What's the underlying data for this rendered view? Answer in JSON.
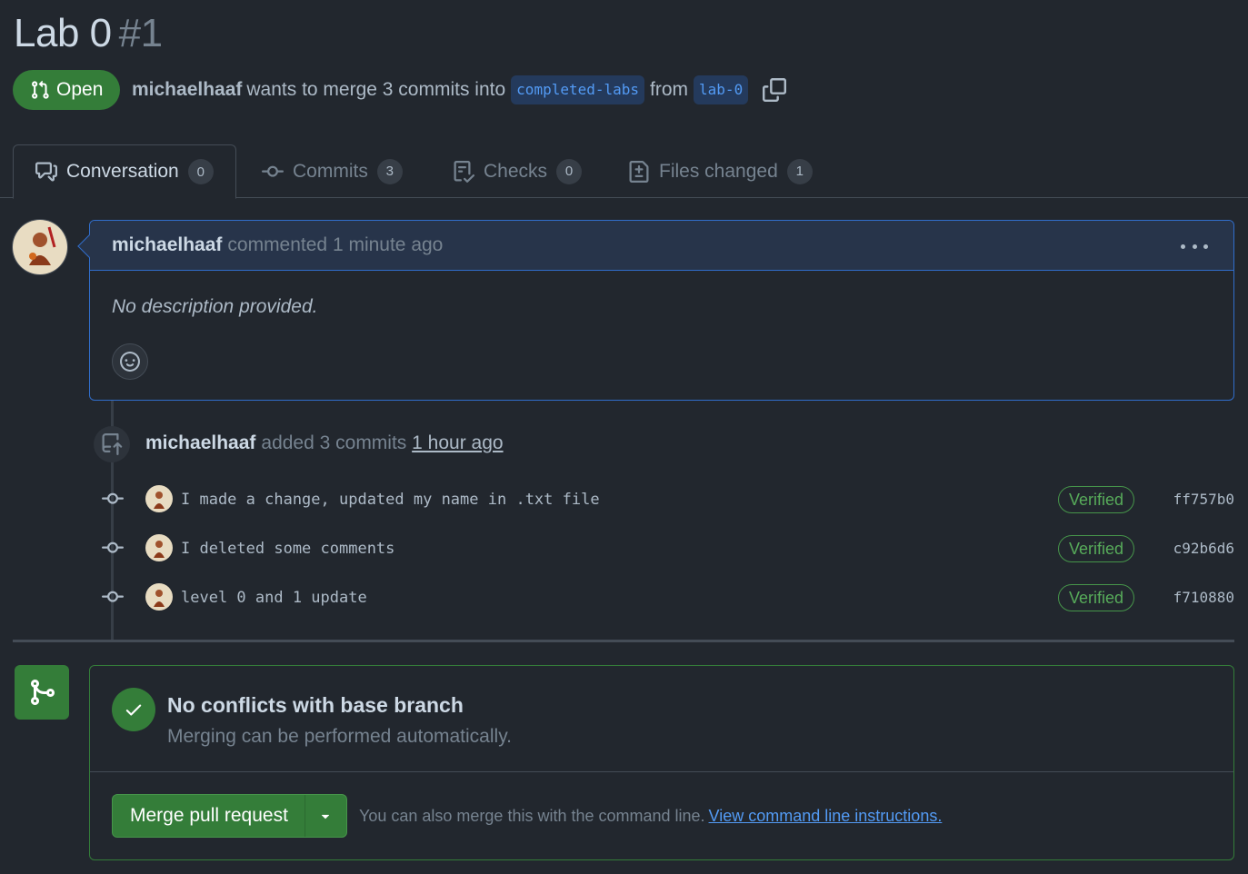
{
  "pr": {
    "title": "Lab 0",
    "number": "#1",
    "state": "Open",
    "author": "michaelhaaf",
    "merge_text": "wants to merge 3 commits into",
    "base_branch": "completed-labs",
    "from_text": "from",
    "head_branch": "lab-0"
  },
  "tabs": [
    {
      "label": "Conversation",
      "count": "0",
      "icon": "comment-discussion-icon"
    },
    {
      "label": "Commits",
      "count": "3",
      "icon": "git-commit-icon"
    },
    {
      "label": "Checks",
      "count": "0",
      "icon": "checklist-icon"
    },
    {
      "label": "Files changed",
      "count": "1",
      "icon": "file-diff-icon"
    }
  ],
  "comment": {
    "author": "michaelhaaf",
    "action": "commented 1 minute ago",
    "body": "No description provided."
  },
  "event": {
    "author": "michaelhaaf",
    "action": "added 3 commits",
    "time": "1 hour ago"
  },
  "commits": [
    {
      "message": "I made a change, updated my name in .txt file",
      "verified": "Verified",
      "sha": "ff757b0"
    },
    {
      "message": "I deleted some comments",
      "verified": "Verified",
      "sha": "c92b6d6"
    },
    {
      "message": "level 0 and 1 update",
      "verified": "Verified",
      "sha": "f710880"
    }
  ],
  "merge": {
    "status_title": "No conflicts with base branch",
    "status_sub": "Merging can be performed automatically.",
    "button_label": "Merge pull request",
    "hint": "You can also merge this with the command line.",
    "hint_link": "View command line instructions."
  },
  "colors": {
    "background": "#22272e",
    "open_green": "#347d39",
    "link_blue": "#539bf5",
    "comment_border": "#316dca"
  }
}
